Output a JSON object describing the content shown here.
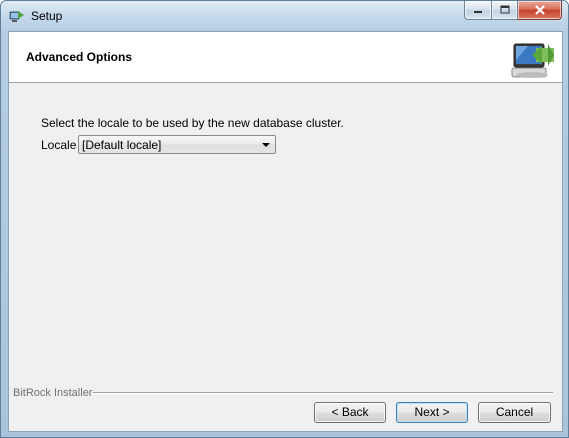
{
  "window": {
    "title": "Setup"
  },
  "header": {
    "title": "Advanced Options",
    "icon": "computer-install-icon"
  },
  "main": {
    "description": "Select the locale to be used by the new database cluster.",
    "locale_label": "Locale",
    "locale_value": "[Default locale]"
  },
  "footer": {
    "installer_label": "BitRock Installer",
    "back_label": "< Back",
    "next_label": "Next >",
    "cancel_label": "Cancel"
  },
  "colors": {
    "close_button": "#c7422b",
    "accent": "#3c7fb1"
  }
}
